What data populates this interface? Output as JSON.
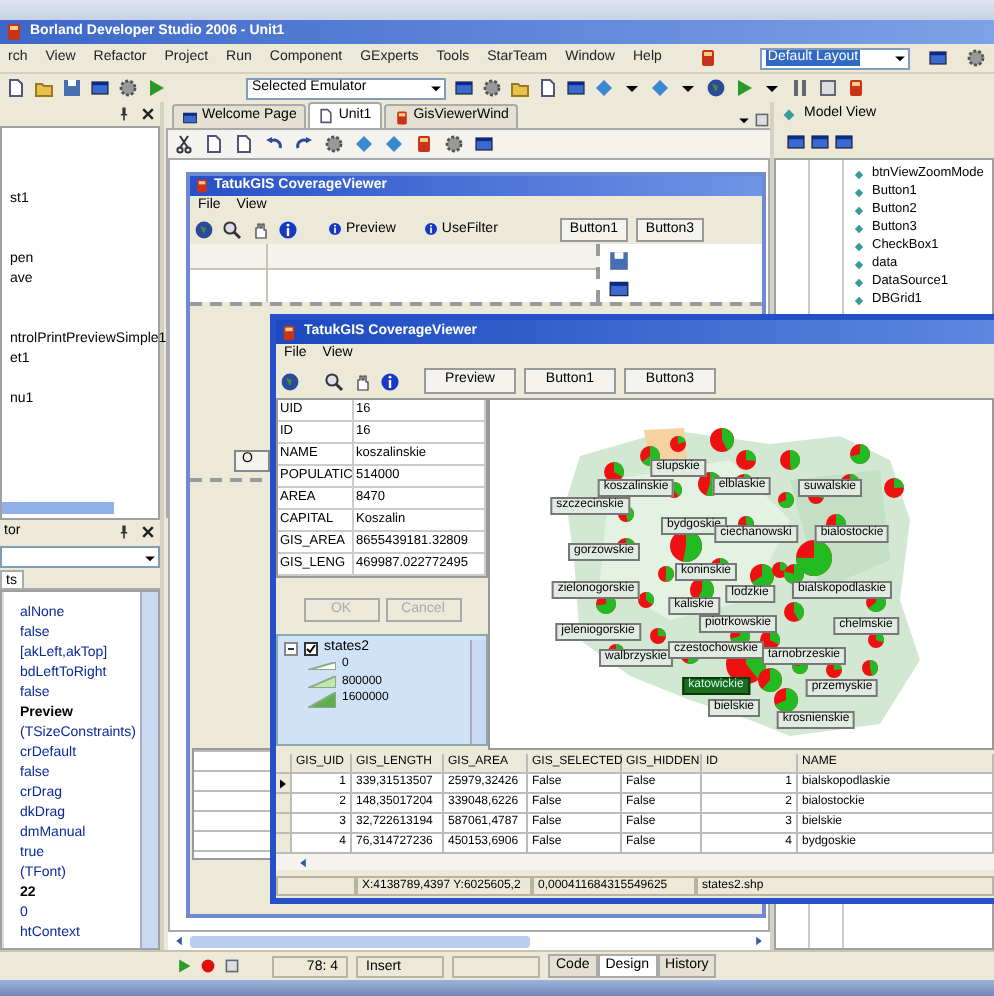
{
  "window": {
    "title": "Borland Developer Studio 2006 - Unit1"
  },
  "menu": [
    "rch",
    "View",
    "Refactor",
    "Project",
    "Run",
    "Component",
    "GExperts",
    "Tools",
    "StarTeam",
    "Window",
    "Help"
  ],
  "layout_combo": {
    "value": "Default Layout"
  },
  "emulator_combo": {
    "value": "Selected Emulator"
  },
  "project_manager": {
    "items": [
      "st1",
      "pen",
      "ave",
      "ntrolPrintPreviewSimple1",
      "et1",
      "nu1"
    ]
  },
  "object_inspector": {
    "title": "tor",
    "tab": "ts",
    "values": [
      {
        "text": "alNone",
        "bold": false
      },
      {
        "text": "false",
        "bold": false
      },
      {
        "text": "[akLeft,akTop]",
        "bold": false
      },
      {
        "text": "bdLeftToRight",
        "bold": false
      },
      {
        "text": "false",
        "bold": false
      },
      {
        "text": "Preview",
        "bold": true
      },
      {
        "text": "(TSizeConstraints)",
        "bold": false
      },
      {
        "text": "crDefault",
        "bold": false
      },
      {
        "text": "false",
        "bold": false
      },
      {
        "text": "crDrag",
        "bold": false
      },
      {
        "text": "dkDrag",
        "bold": false
      },
      {
        "text": "dmManual",
        "bold": false
      },
      {
        "text": "true",
        "bold": false
      },
      {
        "text": "(TFont)",
        "bold": false
      },
      {
        "text": "22",
        "bold": true
      },
      {
        "text": "0",
        "bold": false
      },
      {
        "text": "htContext",
        "bold": false
      }
    ]
  },
  "editor_tabs": [
    {
      "label": "Welcome Page",
      "selected": false
    },
    {
      "label": "Unit1",
      "selected": true
    },
    {
      "label": "GisViewerWind",
      "selected": false
    }
  ],
  "back_form": {
    "title": "TatukGIS CoverageViewer",
    "menu": [
      "File",
      "View"
    ],
    "buttons": [
      "Preview",
      "UseFilter",
      "Button1",
      "Button3"
    ],
    "partial_button": "O"
  },
  "model_view": {
    "title": "Model View",
    "items": [
      "btnViewZoomMode",
      "Button1",
      "Button2",
      "Button3",
      "CheckBox1",
      "data",
      "DataSource1",
      "DBGrid1"
    ]
  },
  "viewer": {
    "title": "TatukGIS CoverageViewer",
    "menu": [
      "File",
      "View"
    ],
    "buttons": [
      "Preview",
      "Button1",
      "Button3"
    ],
    "attributes": [
      {
        "name": "UID",
        "value": "16"
      },
      {
        "name": "ID",
        "value": "16"
      },
      {
        "name": "NAME",
        "value": "koszalinskie"
      },
      {
        "name": "POPULATIC",
        "value": "514000"
      },
      {
        "name": "AREA",
        "value": "8470"
      },
      {
        "name": "CAPITAL",
        "value": "Koszalin"
      },
      {
        "name": "GIS_AREA",
        "value": "8655439181.32809"
      },
      {
        "name": "GIS_LENG",
        "value": "469987.022772495"
      }
    ],
    "dialog_buttons": [
      {
        "label": "OK",
        "disabled": true
      },
      {
        "label": "Cancel",
        "disabled": true
      }
    ],
    "legend": {
      "layer": "states2",
      "checked": true,
      "expanded": true,
      "classes": [
        {
          "label": "0",
          "color": "#ffffff"
        },
        {
          "label": "800000",
          "color": "#c4e4b0"
        },
        {
          "label": "1600000",
          "color": "#5fb04a"
        }
      ]
    },
    "map_labels": [
      {
        "text": "slupskie",
        "selected": false
      },
      {
        "text": "koszalinskie",
        "selected": false
      },
      {
        "text": "elblaskie",
        "selected": false
      },
      {
        "text": "suwalskie",
        "selected": false
      },
      {
        "text": "szczecinskie",
        "selected": false
      },
      {
        "text": "bydgoskie",
        "selected": false
      },
      {
        "text": "ciechanowski",
        "selected": false
      },
      {
        "text": "bialostockie",
        "selected": false
      },
      {
        "text": "gorzowskie",
        "selected": false
      },
      {
        "text": "koninskie",
        "selected": false
      },
      {
        "text": "zielonogorskie",
        "selected": false
      },
      {
        "text": "kaliskie",
        "selected": false
      },
      {
        "text": "lodzkie",
        "selected": false
      },
      {
        "text": "bialskopodlaskie",
        "selected": false
      },
      {
        "text": "jeleniogorskie",
        "selected": false
      },
      {
        "text": "piotrkowskie",
        "selected": false
      },
      {
        "text": "chelmskie",
        "selected": false
      },
      {
        "text": "walbrzyskie",
        "selected": false
      },
      {
        "text": "czestochowskie",
        "selected": false
      },
      {
        "text": "tarnobrzeskie",
        "selected": false
      },
      {
        "text": "katowickie",
        "selected": true
      },
      {
        "text": "przemyskie",
        "selected": false
      },
      {
        "text": "bielskie",
        "selected": false
      },
      {
        "text": "krosnienskie",
        "selected": false
      }
    ],
    "grid": {
      "columns": [
        "GIS_UID",
        "GIS_LENGTH",
        "GIS_AREA",
        "GIS_SELECTED",
        "GIS_HIDDEN",
        "ID",
        "NAME"
      ],
      "rows": [
        {
          "selected": true,
          "cells": [
            "1",
            "339,31513507",
            "25979,32426",
            "False",
            "False",
            "1",
            "bialskopodlaskie"
          ]
        },
        {
          "selected": false,
          "cells": [
            "2",
            "148,35017204",
            "339048,6226",
            "False",
            "False",
            "2",
            "bialostockie"
          ]
        },
        {
          "selected": false,
          "cells": [
            "3",
            "32,722613194",
            "587061,4787",
            "False",
            "False",
            "3",
            "bielskie"
          ]
        },
        {
          "selected": false,
          "cells": [
            "4",
            "76,314727236",
            "450153,6906",
            "False",
            "False",
            "4",
            "bydgoskie"
          ]
        }
      ]
    },
    "status": [
      "X:4138789,4397 Y:6025605,2",
      "0,000411684315549625",
      "states2.shp"
    ]
  },
  "status_bar": {
    "position": "78: 4",
    "mode": "Insert",
    "tabs": [
      {
        "label": "Code",
        "selected": false
      },
      {
        "label": "Design",
        "selected": true
      },
      {
        "label": "History",
        "selected": false
      }
    ]
  }
}
